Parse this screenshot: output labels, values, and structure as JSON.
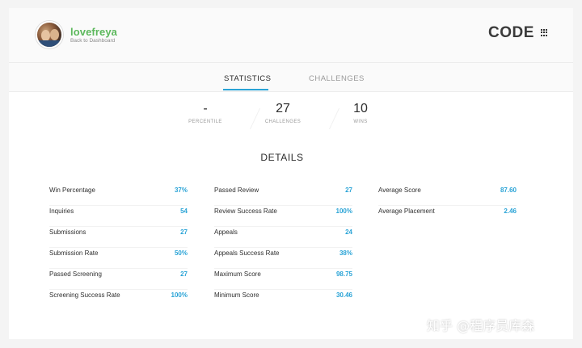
{
  "profile": {
    "username": "lovefreya",
    "back_link": "Back to Dashboard"
  },
  "track": {
    "name": "CODE",
    "menu_icon": "grid-icon"
  },
  "tabs": [
    {
      "label": "STATISTICS",
      "active": true
    },
    {
      "label": "CHALLENGES",
      "active": false
    }
  ],
  "summary": {
    "percentile": {
      "value": "-",
      "label": "PERCENTILE"
    },
    "challenges": {
      "value": "27",
      "label": "CHALLENGES"
    },
    "wins": {
      "value": "10",
      "label": "WINS"
    }
  },
  "details": {
    "title": "DETAILS",
    "col1": [
      {
        "label": "Win Percentage",
        "value": "37%"
      },
      {
        "label": "Inquiries",
        "value": "54"
      },
      {
        "label": "Submissions",
        "value": "27"
      },
      {
        "label": "Submission Rate",
        "value": "50%"
      },
      {
        "label": "Passed Screening",
        "value": "27"
      },
      {
        "label": "Screening Success Rate",
        "value": "100%"
      }
    ],
    "col2": [
      {
        "label": "Passed Review",
        "value": "27"
      },
      {
        "label": "Review Success Rate",
        "value": "100%"
      },
      {
        "label": "Appeals",
        "value": "24"
      },
      {
        "label": "Appeals Success Rate",
        "value": "38%"
      },
      {
        "label": "Maximum Score",
        "value": "98.75"
      },
      {
        "label": "Minimum Score",
        "value": "30.46"
      }
    ],
    "col3": [
      {
        "label": "Average Score",
        "value": "87.60"
      },
      {
        "label": "Average Placement",
        "value": "2.46"
      }
    ]
  },
  "colors": {
    "accent": "#29a3d6",
    "username": "#5cb85c"
  },
  "watermark": "知乎 @程序员库森"
}
